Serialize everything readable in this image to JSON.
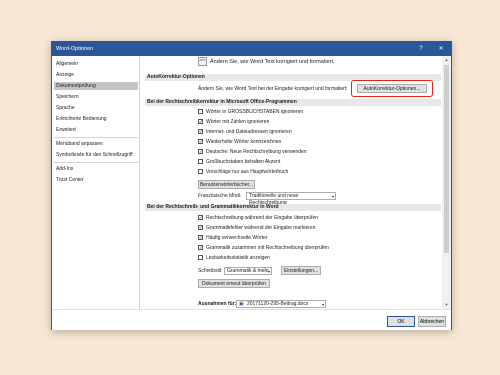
{
  "window": {
    "title": "Word-Optionen",
    "help": "?",
    "close": "✕"
  },
  "sidebar": {
    "items": [
      {
        "label": "Allgemein"
      },
      {
        "label": "Anzeige"
      },
      {
        "label": "Dokumentprüfung"
      },
      {
        "label": "Speichern"
      },
      {
        "label": "Sprache"
      },
      {
        "label": "Erleichterte Bedienung"
      },
      {
        "label": "Erweitert"
      },
      {
        "label": "Menüband anpassen"
      },
      {
        "label": "Symbolleiste für den Schnellzugriff"
      },
      {
        "label": "Add-Ins"
      },
      {
        "label": "Trust Center"
      }
    ]
  },
  "main": {
    "header_text": "Ändern Sie, wie Word Text korrigiert und formatiert.",
    "header_icon": "ABC",
    "autocorrect": {
      "title": "AutoKorrektur-Optionen",
      "text": "Ändern Sie, wie Word Text bei der Eingabe korrigiert und formatiert:",
      "button": "AutoKorrektur-Optionen..."
    },
    "office_section": {
      "title": "Bei der Rechtschreibkorrektur in Microsoft Office-Programmen",
      "options": [
        {
          "label": "Wörter in GROSSBUCHSTABEN ignorieren",
          "checked": false
        },
        {
          "label": "Wörter mit Zahlen ignorieren",
          "checked": true
        },
        {
          "label": "Internet- und Dateiadressen ignorieren",
          "checked": true
        },
        {
          "label": "Wiederholte Wörter kennzeichnen",
          "checked": true
        },
        {
          "label": "Deutsche: Neue Rechtschreibung verwenden",
          "checked": true
        },
        {
          "label": "Großbuchstaben behalten Akzent",
          "checked": false
        },
        {
          "label": "Vorschläge nur aus Hauptwörterbuch",
          "checked": false
        }
      ],
      "dict_button": "Benutzerwörterbücher...",
      "french_label": "Französische Modi:",
      "french_value": "Traditionelle und neue Rechtschreibung"
    },
    "word_section": {
      "title": "Bei der Rechtschreib- und Grammatikkorrektur in Word",
      "options": [
        {
          "label": "Rechtschreibung während der Eingabe überprüfen",
          "checked": true
        },
        {
          "label": "Grammatikfehler während der Eingabe markieren",
          "checked": true
        },
        {
          "label": "Häufig verwechselte Wörter",
          "checked": true
        },
        {
          "label": "Grammatik zusammen mit Rechtschreibung überprüfen",
          "checked": true
        },
        {
          "label": "Lesbarkeitsstatistik anzeigen",
          "checked": false
        }
      ],
      "style_label": "Schreibstil:",
      "style_value": "Grammatik & mehr",
      "settings_button": "Einstellungen...",
      "recheck_button": "Dokument erneut überprüfen"
    },
    "exceptions": {
      "label": "Ausnahmen für:",
      "value": "20171120-295-Beitrag.docx"
    }
  },
  "footer": {
    "ok": "OK",
    "cancel": "Abbrechen"
  },
  "colors": {
    "titlebar": "#2b579a",
    "highlight": "#e1251b",
    "background": "#f7e6d3"
  }
}
